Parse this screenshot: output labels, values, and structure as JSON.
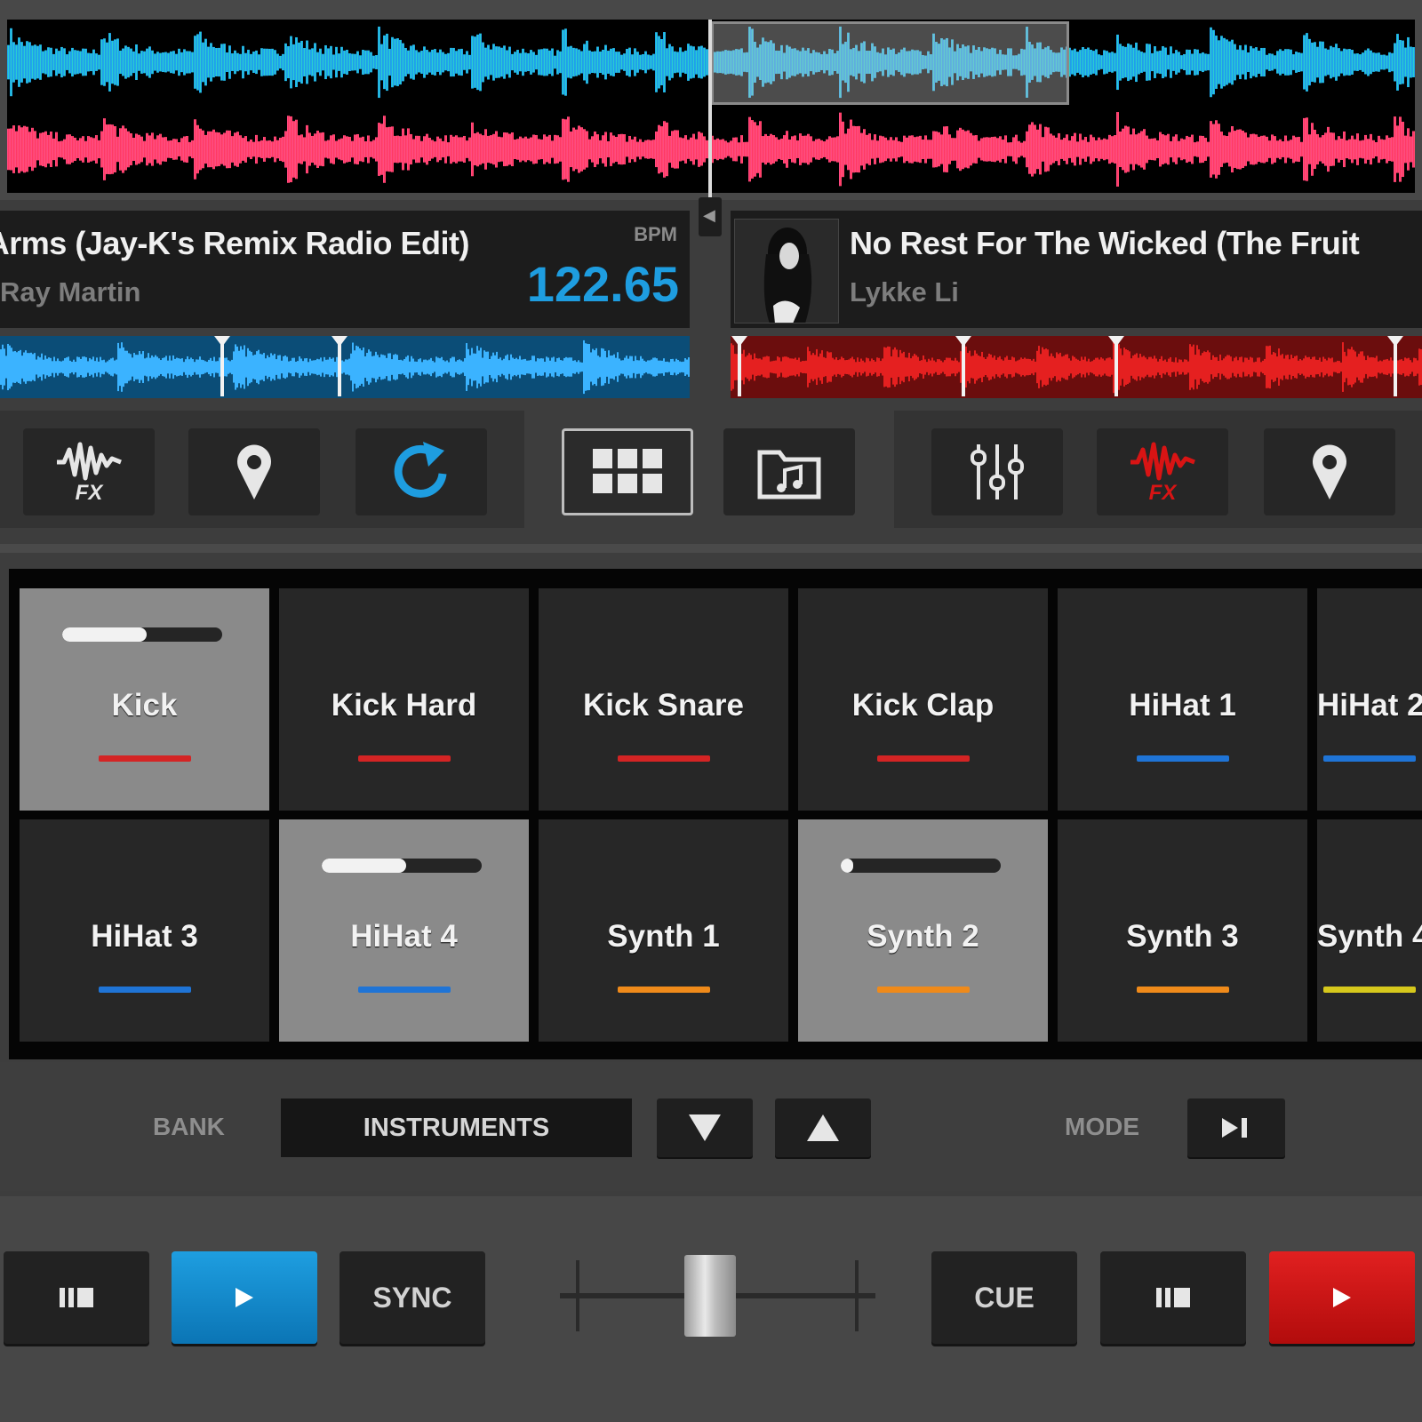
{
  "deck_left": {
    "title": "Loving Arms (Jay-K's Remix Radio Edit)",
    "artist": "Ray Martin",
    "bpm_label": "BPM",
    "bpm": "122.65",
    "color": "#1e9de0"
  },
  "deck_right": {
    "title": "No Rest For The Wicked (The Fruit",
    "artist": "Lykke Li",
    "color": "#d81414"
  },
  "toolbar": {
    "left": [
      {
        "name": "fx-left-button",
        "icon": "fx-wave-icon",
        "label": "FX"
      },
      {
        "name": "cue-points-left-button",
        "icon": "location-pin-icon"
      },
      {
        "name": "loop-left-button",
        "icon": "loop-arrow-icon"
      }
    ],
    "center": [
      {
        "name": "pads-view-button",
        "icon": "grid-icon",
        "active": true
      },
      {
        "name": "browser-button",
        "icon": "music-folder-icon"
      }
    ],
    "right": [
      {
        "name": "mixer-button",
        "icon": "sliders-icon"
      },
      {
        "name": "fx-right-button",
        "icon": "fx-wave-icon",
        "label": "FX"
      },
      {
        "name": "cue-points-right-button",
        "icon": "location-pin-icon"
      }
    ]
  },
  "pads": [
    {
      "label": "Kick",
      "color": "#d42424",
      "active": true,
      "level": 0.53
    },
    {
      "label": "Kick Hard",
      "color": "#d42424"
    },
    {
      "label": "Kick Snare",
      "color": "#d42424"
    },
    {
      "label": "Kick Clap",
      "color": "#d42424"
    },
    {
      "label": "HiHat 1",
      "color": "#1f74d6"
    },
    {
      "label": "HiHat 2",
      "color": "#1f74d6"
    },
    {
      "label": "HiHat 3",
      "color": "#1f74d6"
    },
    {
      "label": "HiHat 4",
      "color": "#1f74d6",
      "active": true,
      "level": 0.53
    },
    {
      "label": "Synth 1",
      "color": "#ef8a1a"
    },
    {
      "label": "Synth 2",
      "color": "#ef8a1a",
      "active": true,
      "level": 0.04
    },
    {
      "label": "Synth 3",
      "color": "#ef8a1a"
    },
    {
      "label": "Synth 4",
      "color": "#d6c81c"
    }
  ],
  "bank": {
    "label": "BANK",
    "value": "INSTRUMENTS",
    "down_icon": "triangle-down-icon",
    "up_icon": "triangle-up-icon"
  },
  "mode": {
    "label": "MODE",
    "icon": "play-pause-icon"
  },
  "transport_left": {
    "pause_icon": "pause-icon",
    "play_icon": "play-icon",
    "sync_label": "SYNC"
  },
  "transport_right": {
    "cue_label": "CUE",
    "pause_icon": "pause-icon",
    "play_icon": "play-icon"
  },
  "crossfader": {
    "position": 0.47
  }
}
